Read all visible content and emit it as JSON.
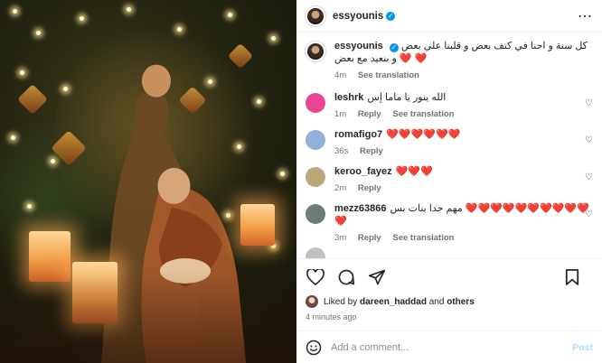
{
  "header": {
    "username": "essyounis",
    "verified": "✓",
    "more_icon": "more-icon"
  },
  "caption": {
    "username": "essyounis",
    "text": "كل سنة و احنا في كتف بعض و قلبنا علي بعض و بنعيد مع بعض",
    "hearts": "❤️ ❤️",
    "time": "4m",
    "see_translation": "See translation"
  },
  "comments": [
    {
      "username": "leshrk",
      "text": "الله ينور يا ماما إس",
      "hearts": "",
      "time": "1m",
      "reply": "Reply",
      "see_translation": "See translation",
      "avatar_color": "#e84593"
    },
    {
      "username": "romafigo7",
      "text": "",
      "hearts": "❤️❤️❤️❤️❤️❤️",
      "time": "36s",
      "reply": "Reply",
      "see_translation": "",
      "avatar_color": "#8fb2d6"
    },
    {
      "username": "keroo_fayez",
      "text": "",
      "hearts": "❤️❤️❤️",
      "time": "2m",
      "reply": "Reply",
      "see_translation": "",
      "avatar_color": "#b8a87a"
    },
    {
      "username": "mezz63866",
      "text": "مهم جدا بنات بس",
      "hearts": "❤️❤️❤️❤️❤️❤️❤️❤️❤️❤️❤️",
      "time": "3m",
      "reply": "Reply",
      "see_translation": "See translation",
      "avatar_color": "#6c7c78"
    }
  ],
  "likes": {
    "prefix": "Liked by",
    "user": "dareen_haddad",
    "and": "and",
    "others": "others"
  },
  "timestamp": "4 minutes ago",
  "add_comment": {
    "placeholder": "Add a comment...",
    "post_label": "Post"
  },
  "colors": {
    "accent": "#0095f6",
    "heart": "#ed1c24",
    "post_disabled": "#b2dffc"
  }
}
